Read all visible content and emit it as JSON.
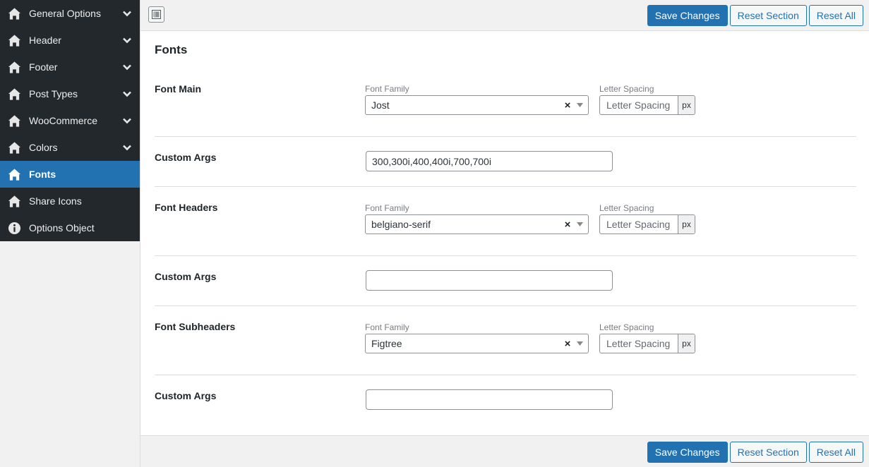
{
  "sidebar": {
    "items": [
      {
        "label": "General Options",
        "icon": "home-icon",
        "chevron": true,
        "active": false
      },
      {
        "label": "Header",
        "icon": "home-icon",
        "chevron": true,
        "active": false
      },
      {
        "label": "Footer",
        "icon": "home-icon",
        "chevron": true,
        "active": false
      },
      {
        "label": "Post Types",
        "icon": "home-icon",
        "chevron": true,
        "active": false
      },
      {
        "label": "WooCommerce",
        "icon": "home-icon",
        "chevron": true,
        "active": false
      },
      {
        "label": "Colors",
        "icon": "home-icon",
        "chevron": true,
        "active": false
      },
      {
        "label": "Fonts",
        "icon": "home-icon",
        "chevron": false,
        "active": true
      },
      {
        "label": "Share Icons",
        "icon": "home-icon",
        "chevron": false,
        "active": false
      },
      {
        "label": "Options Object",
        "icon": "info-icon",
        "chevron": false,
        "active": false
      }
    ]
  },
  "toolbar": {
    "save_label": "Save Changes",
    "reset_section_label": "Reset Section",
    "reset_all_label": "Reset All"
  },
  "section": {
    "title": "Fonts"
  },
  "fields": {
    "font_main": {
      "label": "Font Main",
      "family_caption": "Font Family",
      "family_value": "Jost",
      "spacing_caption": "Letter Spacing",
      "spacing_placeholder": "Letter Spacing",
      "unit": "px"
    },
    "custom_args_main": {
      "label": "Custom Args",
      "value": "300,300i,400,400i,700,700i"
    },
    "font_headers": {
      "label": "Font Headers",
      "family_caption": "Font Family",
      "family_value": "belgiano-serif",
      "spacing_caption": "Letter Spacing",
      "spacing_placeholder": "Letter Spacing",
      "unit": "px"
    },
    "custom_args_headers": {
      "label": "Custom Args",
      "value": ""
    },
    "font_subheaders": {
      "label": "Font Subheaders",
      "family_caption": "Font Family",
      "family_value": "Figtree",
      "spacing_caption": "Letter Spacing",
      "spacing_placeholder": "Letter Spacing",
      "unit": "px"
    },
    "custom_args_subheaders": {
      "label": "Custom Args",
      "value": ""
    }
  },
  "select_clear_glyph": "×",
  "colors": {
    "sidebar_bg": "#23282d",
    "active_bg": "#2271b1",
    "primary": "#2271b1"
  }
}
